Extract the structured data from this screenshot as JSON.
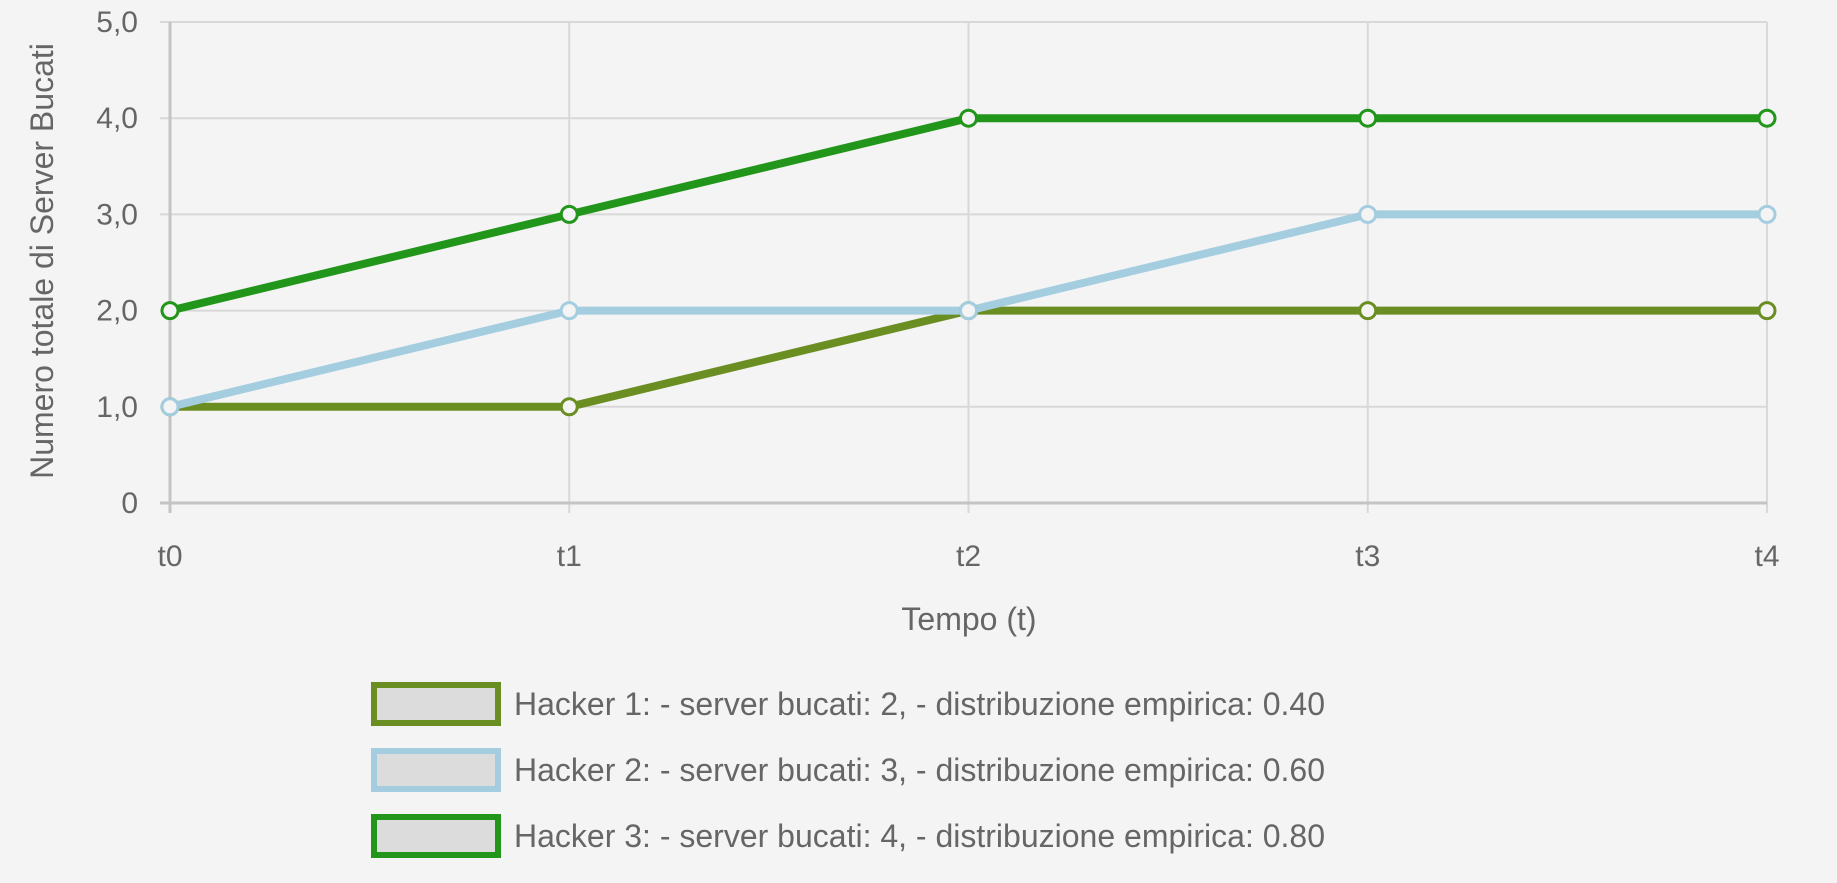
{
  "chart_data": {
    "type": "line",
    "categories": [
      "t0",
      "t1",
      "t2",
      "t3",
      "t4"
    ],
    "xlabel": "Tempo (t)",
    "ylabel": "Numero totale di Server Bucati",
    "ylim": [
      0,
      5
    ],
    "yticks": [
      0,
      1,
      2,
      3,
      4,
      5
    ],
    "ytick_labels": [
      "0",
      "1,0",
      "2,0",
      "3,0",
      "4,0",
      "5,0"
    ],
    "grid": true,
    "legend_position": "bottom",
    "series": [
      {
        "name": "Hacker 1: - server bucati: 2, - distribuzione empirica: 0.40",
        "values": [
          1,
          1,
          2,
          2,
          2
        ],
        "color": "#6b8e23"
      },
      {
        "name": "Hacker 2: - server bucati: 3, - distribuzione empirica: 0.60",
        "values": [
          1,
          2,
          2,
          3,
          3
        ],
        "color": "#a4cddf"
      },
      {
        "name": "Hacker 3: - server bucati: 4, - distribuzione empirica: 0.80",
        "values": [
          2,
          3,
          4,
          4,
          4
        ],
        "color": "#22961a"
      }
    ],
    "colors": {
      "background": "#f4f4f4",
      "grid": "#d8d8d8",
      "axis": "#c4c4c4",
      "text": "#666666",
      "legend_fill": "#dcdcdc"
    }
  }
}
